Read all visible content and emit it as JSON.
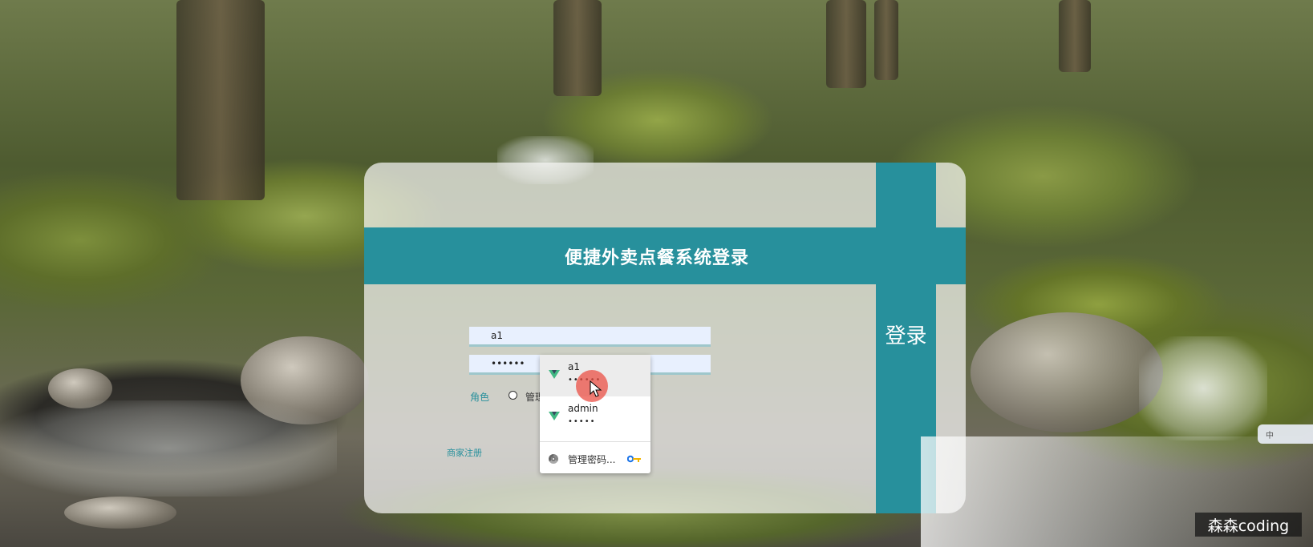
{
  "page": {
    "title": "便捷外卖点餐系统登录",
    "login_button": "登录",
    "username_value": "a1",
    "password_value": "••••••",
    "role_label": "角色",
    "role_option_visible": "管理",
    "register_link": "商家注册"
  },
  "autofill": {
    "items": [
      {
        "username": "a1",
        "password": "••••••"
      },
      {
        "username": "admin",
        "password": "•••••"
      }
    ],
    "manage_passwords": "管理密码...",
    "manage_icon": "chrome-icon",
    "key_icon": "key-icon",
    "entry_icon": "vue-icon"
  },
  "overlay": {
    "watermark": "森森coding",
    "ime_indicator": "中"
  },
  "colors": {
    "accent": "#27909c",
    "field_bg": "#e8f0fe",
    "cursor_halo": "#eb5046"
  }
}
